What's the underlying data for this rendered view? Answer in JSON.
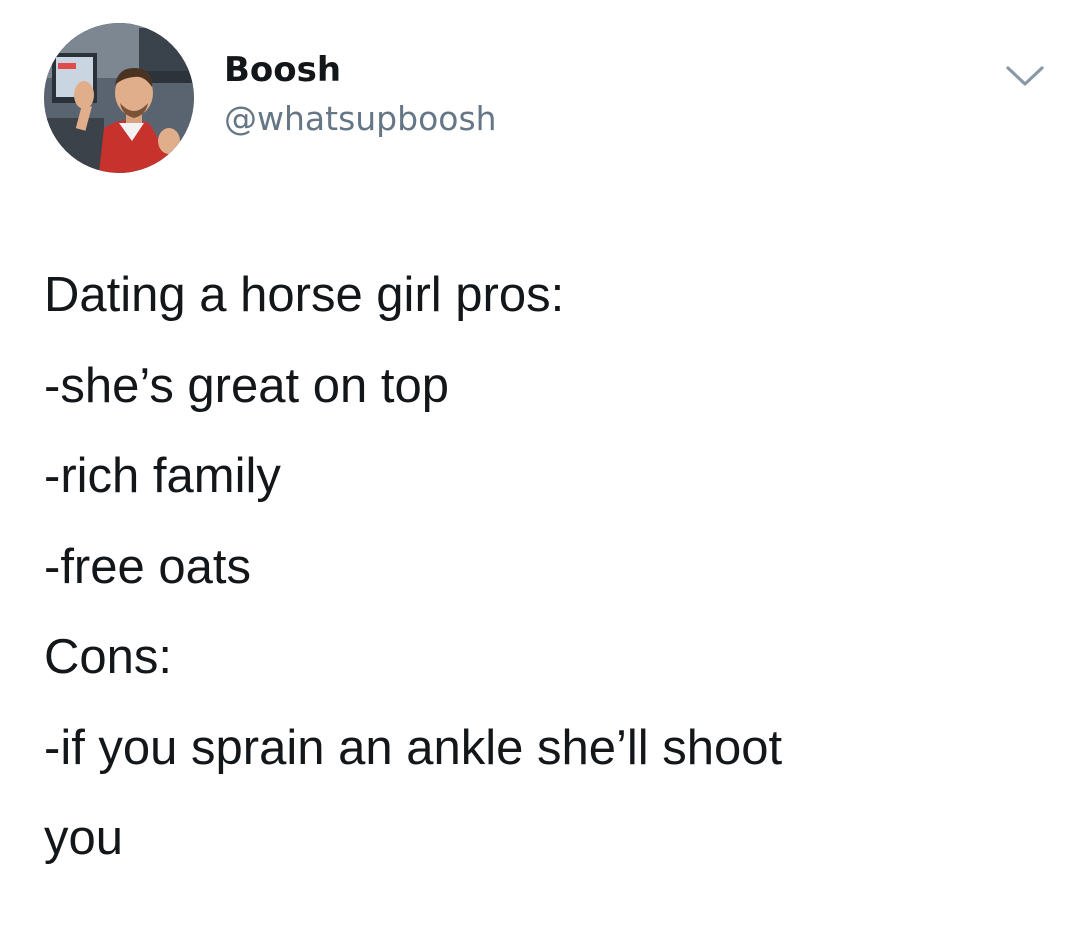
{
  "tweet": {
    "author": {
      "display_name": "Boosh",
      "handle": "@whatsupboosh",
      "avatar_icon": "user-avatar-photo"
    },
    "menu_icon": "chevron-down-icon",
    "lines": [
      "Dating a horse girl pros:",
      "-she’s great on top",
      "-rich family",
      "-free oats",
      "Cons:",
      "-if you sprain an ankle she’ll shoot",
      "you"
    ]
  },
  "colors": {
    "text_primary": "#14171a",
    "text_secondary": "#657786",
    "background": "#ffffff",
    "chevron": "#8899a6"
  }
}
